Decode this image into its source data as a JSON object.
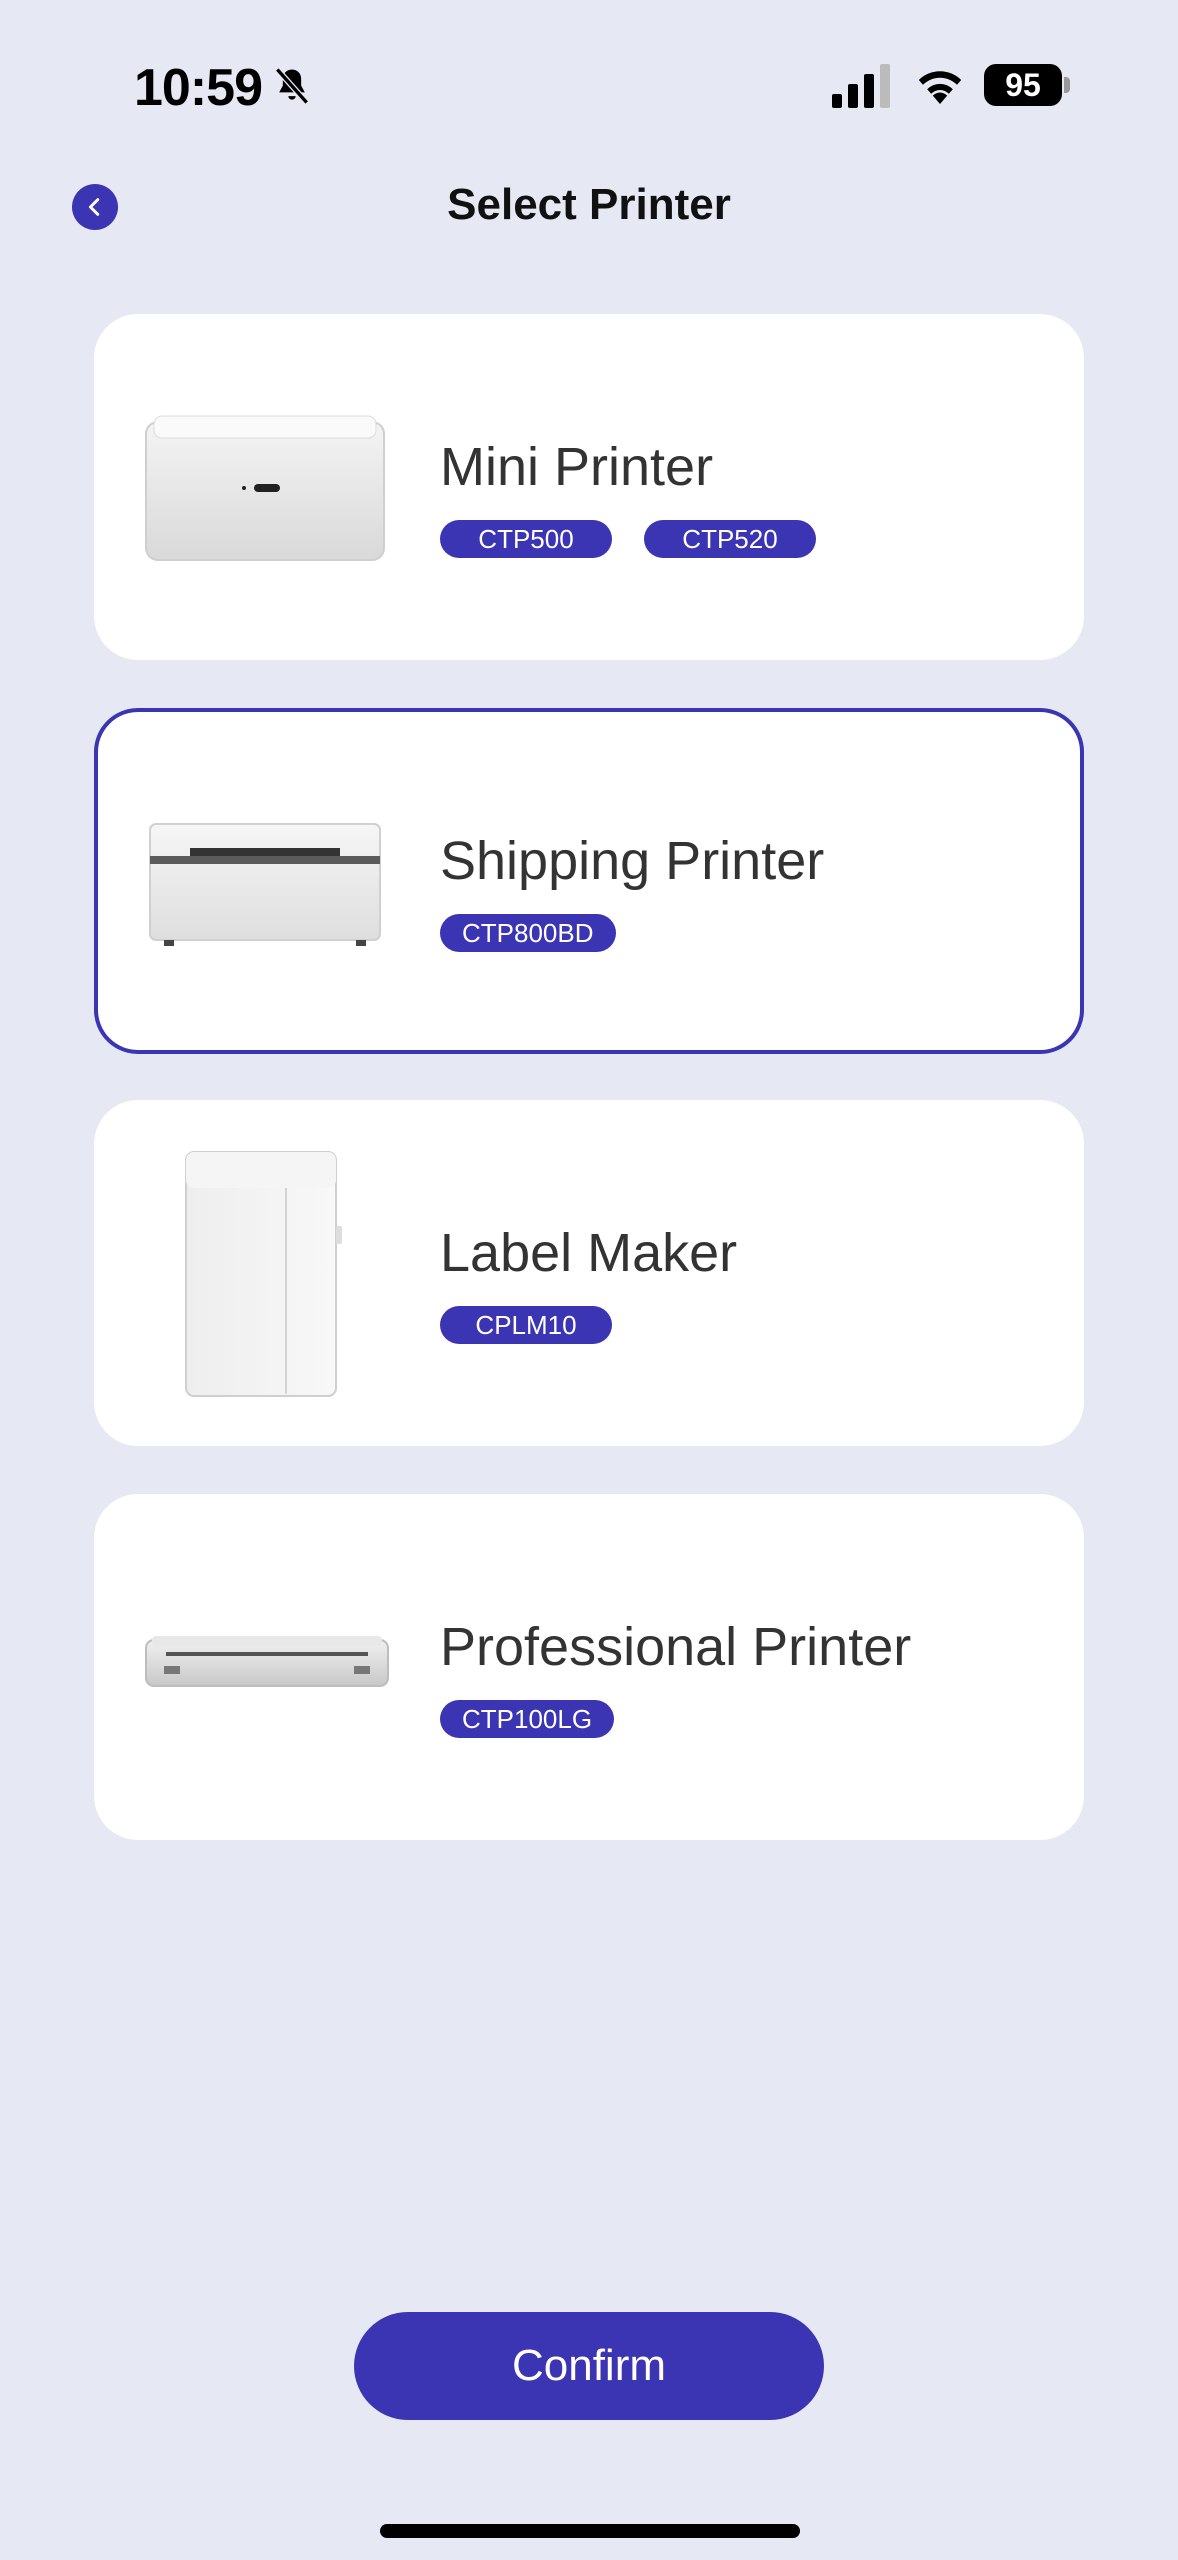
{
  "status_bar": {
    "time": "10:59",
    "battery": "95",
    "icons": [
      "bell-slash-icon",
      "cellular-signal-icon",
      "wifi-icon",
      "battery-icon"
    ]
  },
  "header": {
    "title": "Select Printer",
    "back_icon": "chevron-left-icon"
  },
  "printers": [
    {
      "title": "Mini Printer",
      "tags": [
        "CTP500",
        "CTP520"
      ],
      "selected": false,
      "image": "mini-printer-image"
    },
    {
      "title": "Shipping Printer",
      "tags": [
        "CTP800BD"
      ],
      "selected": true,
      "image": "shipping-printer-image"
    },
    {
      "title": "Label Maker",
      "tags": [
        "CPLM10"
      ],
      "selected": false,
      "image": "label-maker-image"
    },
    {
      "title": "Professional Printer",
      "tags": [
        "CTP100LG"
      ],
      "selected": false,
      "image": "professional-printer-image"
    }
  ],
  "footer": {
    "confirm_label": "Confirm"
  },
  "colors": {
    "accent": "#3b35b4",
    "background": "#e6e8f3",
    "card": "#ffffff"
  }
}
